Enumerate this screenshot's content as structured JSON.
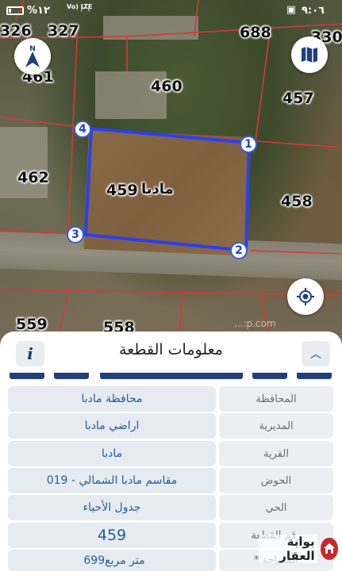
{
  "status_bar": {
    "time": "٩:٠٦",
    "battery": "%١٢",
    "network": "Vo) LTE"
  },
  "map": {
    "parcel_center_label": "مادبا",
    "plot_numbers": [
      "326",
      "327",
      "688",
      "330",
      "461",
      "460",
      "457",
      "462",
      "459",
      "458",
      "559",
      "558"
    ],
    "vertices": [
      "1",
      "2",
      "3",
      "4"
    ],
    "compass_label": "N"
  },
  "panel": {
    "title": "معلومات القطعة",
    "rows": [
      {
        "label": "المحافظة",
        "value": "محافظة مادبا"
      },
      {
        "label": "المديرية",
        "value": "اراضي مادبا"
      },
      {
        "label": "القرية",
        "value": "مادبا"
      },
      {
        "label": "الحوض",
        "value": "مقاسم مادبا الشمالي - 019"
      },
      {
        "label": "الحي",
        "value": "جدول الأحياء"
      },
      {
        "label": "رقم القطعة",
        "value": "459"
      },
      {
        "label": "المساحة *",
        "value": "متر مربع",
        "value_number": "699"
      }
    ]
  },
  "watermark": {
    "text": "بوابة العقار"
  },
  "colors": {
    "parcel_outline": "#2b3ff0",
    "boundary_lines": "#d23a3a",
    "panel_value_text": "#1f5d9a",
    "header_buttons": "#1a3a7a"
  }
}
